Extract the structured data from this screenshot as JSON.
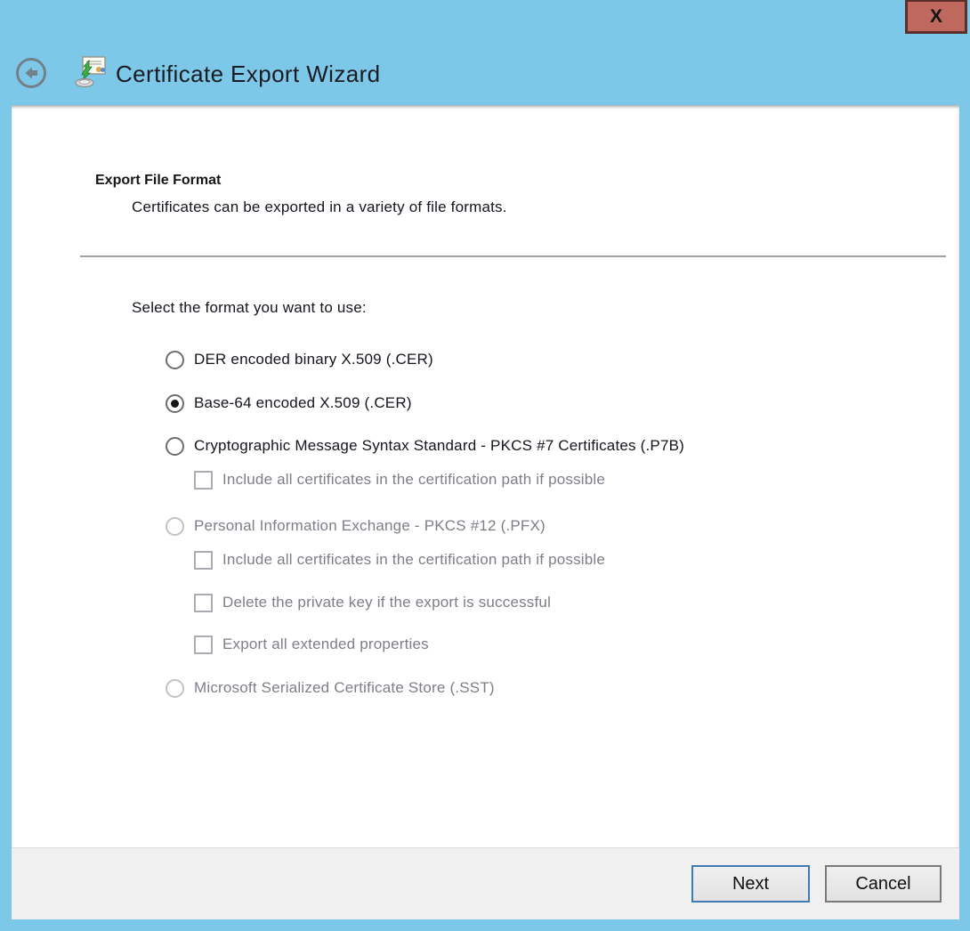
{
  "titlebar": {
    "title": "Certificate Export Wizard",
    "close_label": "x",
    "back_icon": "back-arrow",
    "app_icon": "certificate-export-wizard-icon"
  },
  "content": {
    "heading": "Export File Format",
    "subheading": "Certificates can be exported in a variety of file formats.",
    "select_label": "Select the format you want to use:"
  },
  "formats": {
    "options": [
      {
        "type": "radio",
        "label": "DER encoded binary X.509 (.CER)",
        "selected": false,
        "enabled": true
      },
      {
        "type": "radio",
        "label": "Base-64 encoded X.509 (.CER)",
        "selected": true,
        "enabled": true
      },
      {
        "type": "radio",
        "label": "Cryptographic Message Syntax Standard - PKCS #7 Certificates (.P7B)",
        "selected": false,
        "enabled": true
      },
      {
        "type": "checkbox",
        "label": "Include all certificates in the certification path if possible",
        "checked": false,
        "enabled": false
      },
      {
        "type": "radio",
        "label": "Personal Information Exchange - PKCS #12 (.PFX)",
        "selected": false,
        "enabled": false
      },
      {
        "type": "checkbox",
        "label": "Include all certificates in the certification path if possible",
        "checked": false,
        "enabled": false
      },
      {
        "type": "checkbox",
        "label": "Delete the private key if the export is successful",
        "checked": false,
        "enabled": false
      },
      {
        "type": "checkbox",
        "label": "Export all extended properties",
        "checked": false,
        "enabled": false
      },
      {
        "type": "radio",
        "label": "Microsoft Serialized Certificate Store (.SST)",
        "selected": false,
        "enabled": false
      }
    ]
  },
  "footer": {
    "next_label": "Next",
    "cancel_label": "Cancel"
  },
  "colors": {
    "frame_blue": "#7dc8e8",
    "close_red": "#bf685e",
    "next_border_blue": "#3f7bb6",
    "enabled_text": "#15151e",
    "disabled_text": "#7e7e88",
    "footer_gray": "#f0f0f0"
  }
}
